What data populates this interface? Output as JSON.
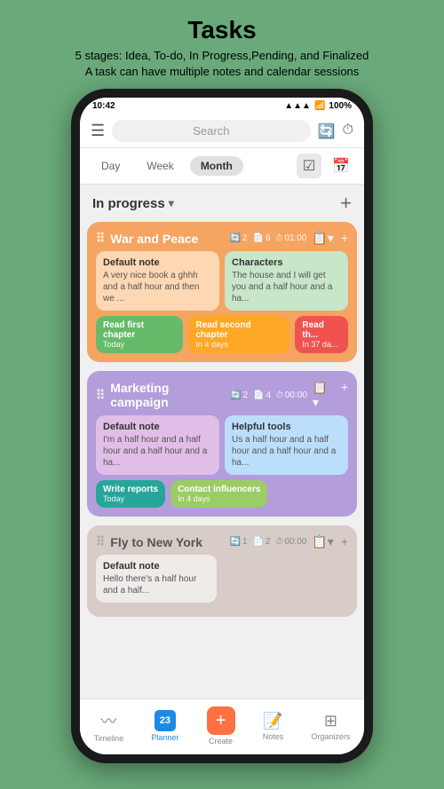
{
  "header": {
    "title": "Tasks",
    "subtitle1": "5 stages: Idea, To-do, In Progress,Pending, and Finalized",
    "subtitle2": "A task can have multiple notes and calendar sessions"
  },
  "statusBar": {
    "time": "10:42",
    "battery": "100%"
  },
  "topBar": {
    "searchPlaceholder": "Search"
  },
  "dateTabs": {
    "day": "Day",
    "week": "Week",
    "month": "Month"
  },
  "sectionTitle": "In progress",
  "tasks": [
    {
      "id": "war-and-peace",
      "title": "War and Peace",
      "meta": [
        {
          "icon": "🔄",
          "value": "2"
        },
        {
          "icon": "📄",
          "value": "6"
        },
        {
          "icon": "⏱",
          "value": "01:00"
        }
      ],
      "colorClass": "orange",
      "notes": [
        {
          "title": "Default note",
          "content": "A very nice book a ghhh and a half hour and then we ...",
          "colorClass": "light-orange"
        },
        {
          "title": "Characters",
          "content": "The house and I will get you and a half hour and a ha...",
          "colorClass": "light-green"
        }
      ],
      "sessions": [
        {
          "label": "Read first chapter",
          "sub": "Today",
          "pillClass": "pill-green"
        },
        {
          "label": "Read second chapter",
          "sub": "In 4 days",
          "pillClass": "pill-yellow"
        },
        {
          "label": "Read th...",
          "sub": "In 37 da...",
          "pillClass": "pill-red"
        }
      ]
    },
    {
      "id": "marketing-campaign",
      "title": "Marketing campaign",
      "meta": [
        {
          "icon": "🔄",
          "value": "2"
        },
        {
          "icon": "📄",
          "value": "4"
        },
        {
          "icon": "⏱",
          "value": "00:00"
        }
      ],
      "colorClass": "purple",
      "notes": [
        {
          "title": "Default note",
          "content": "I'm a half hour and a half hour and a half hour and a ha...",
          "colorClass": "light-purple"
        },
        {
          "title": "Helpful tools",
          "content": "Us a half hour and a half hour and a half hour and a ha...",
          "colorClass": "light-blue"
        }
      ],
      "sessions": [
        {
          "label": "Write reports",
          "sub": "Today",
          "pillClass": "pill-teal"
        },
        {
          "label": "Contact influencers",
          "sub": "In 4 days",
          "pillClass": "pill-lime"
        }
      ]
    },
    {
      "id": "fly-to-new-york",
      "title": "Fly to New York",
      "meta": [
        {
          "icon": "🔄",
          "value": "1"
        },
        {
          "icon": "📄",
          "value": "2"
        },
        {
          "icon": "⏱",
          "value": "00:00"
        }
      ],
      "colorClass": "beige",
      "notes": [
        {
          "title": "Default note",
          "content": "Hello there's a half hour and a half...",
          "colorClass": "light-beige"
        }
      ],
      "sessions": []
    }
  ],
  "bottomNav": [
    {
      "id": "timeline",
      "label": "Timeline",
      "icon": "📈",
      "active": false
    },
    {
      "id": "planner",
      "label": "Planner",
      "icon": "📅",
      "active": true
    },
    {
      "id": "create",
      "label": "Create",
      "icon": "+",
      "active": false
    },
    {
      "id": "notes",
      "label": "Notes",
      "icon": "📝",
      "active": false
    },
    {
      "id": "organizers",
      "label": "Organizers",
      "icon": "⊞",
      "active": false
    }
  ]
}
